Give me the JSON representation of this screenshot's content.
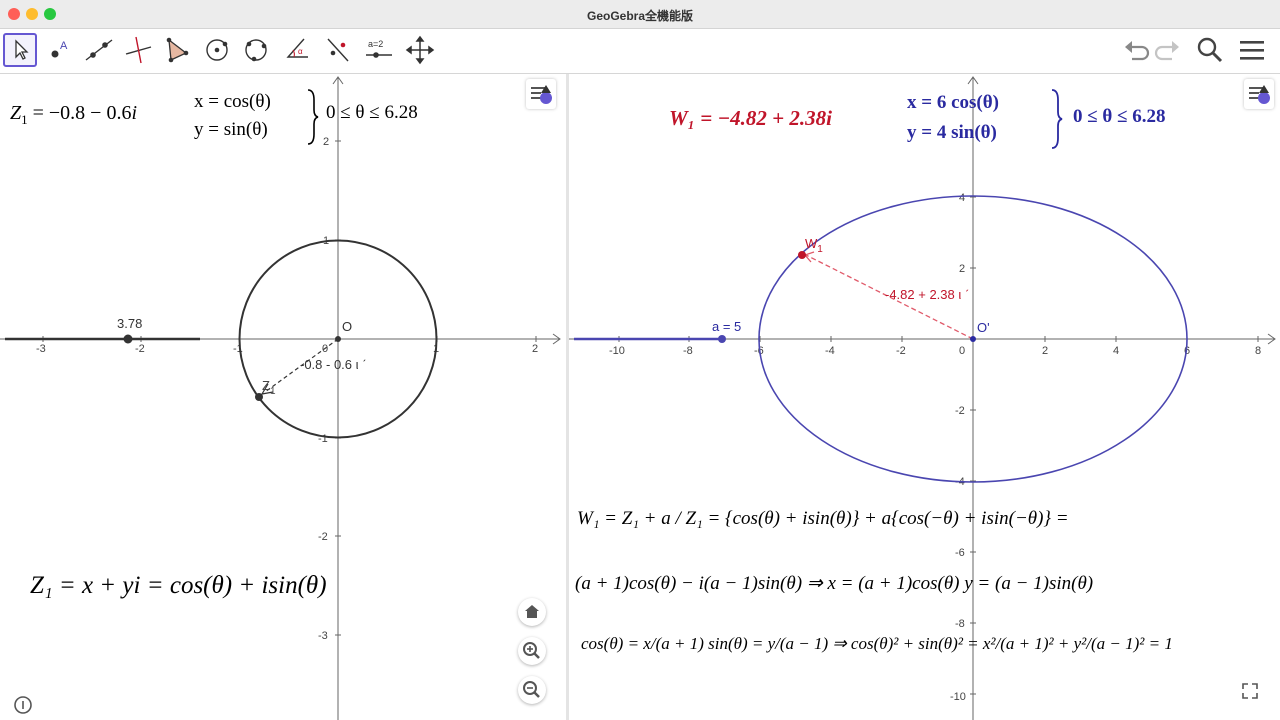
{
  "window": {
    "title": "GeoGebra全機能版"
  },
  "colors": {
    "accent": "#6557d2",
    "red": "#c0152a",
    "blue": "#2a2aa0",
    "curve1": "#333333",
    "curve2": "#4a46b0",
    "dash_red": "#e05a6a"
  },
  "toolbar": {
    "tools": [
      "move-tool-icon",
      "point-tool-icon",
      "line-tool-icon",
      "perpendicular-tool-icon",
      "polygon-tool-icon",
      "circle-tool-icon",
      "circle-three-points-tool-icon",
      "angle-tool-icon",
      "reflect-tool-icon",
      "slider-tool-icon",
      "move-view-tool-icon"
    ],
    "slider_label": "a=2",
    "right": [
      "undo-icon",
      "redo-icon",
      "search-icon",
      "menu-icon"
    ]
  },
  "view1": {
    "eq_lhs": "Z",
    "eq_sub": "1",
    "eq_rhs": " = −0.8 − 0.6",
    "eq_i": "i",
    "param_x": "x = cos(θ)",
    "param_y": "y = sin(θ)",
    "param_range": "0 ≤ θ ≤ 6.28",
    "bottom_eq": "Z₁ = x + yi = cos(θ) + isin(θ)",
    "slider_value": "3.78",
    "label_O": "O",
    "label_Z": "Z",
    "label_Z_sub": "1",
    "vector_label": "-0.8 - 0.6 ι ˊ",
    "x_ticks": [
      "-3",
      "-2",
      "-1",
      "0",
      "1",
      "2"
    ],
    "y_ticks": [
      "2",
      "1",
      "-1",
      "-2",
      "-3"
    ]
  },
  "view2": {
    "eq": "W₁ = −4.82 + 2.38i",
    "param_x": "x = 6 cos(θ)",
    "param_y": "y = 4 sin(θ)",
    "param_range": "0 ≤ θ ≤ 6.28",
    "slider_label": "a = 5",
    "label_O": "O'",
    "label_W": "W",
    "label_W_sub": "1",
    "vector_label": "-4.82 + 2.38 ι ˊ",
    "x_ticks": [
      "-10",
      "-8",
      "-6",
      "-4",
      "-2",
      "0",
      "2",
      "4",
      "6",
      "8"
    ],
    "y_ticks": [
      "4",
      "2",
      "-2",
      "-4",
      "-6",
      "-8",
      "-10"
    ],
    "formula1": "W₁ = Z₁ + a / Z₁ = {cos(θ) + isin(θ)} + a{cos(−θ) + isin(−θ)} =",
    "formula2": "(a + 1)cos(θ) − i(a − 1)sin(θ) ⇒ x = (a + 1)cos(θ)  y = (a − 1)sin(θ)",
    "formula3": "cos(θ) = x/(a + 1)  sin(θ) = y/(a − 1) ⇒ cos(θ)² + sin(θ)² = x²/(a + 1)² + y²/(a − 1)² = 1"
  },
  "zoom": [
    "home-icon",
    "zoom-in-icon",
    "zoom-out-icon"
  ]
}
